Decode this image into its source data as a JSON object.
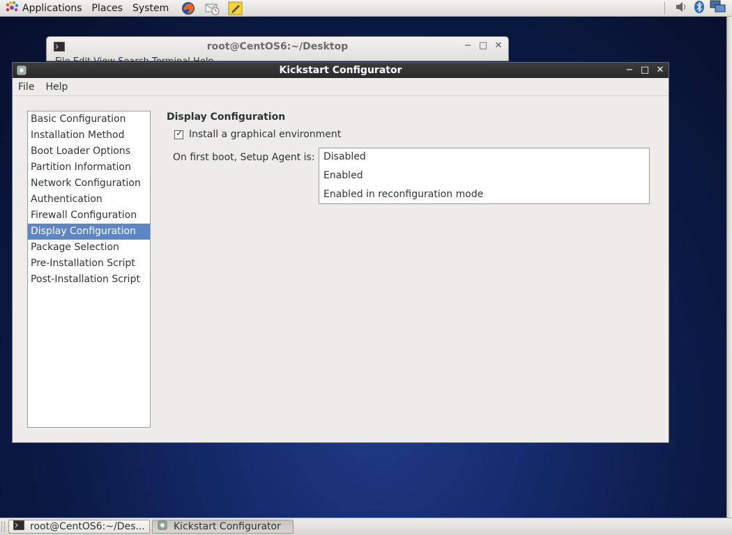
{
  "top_panel": {
    "menus": [
      {
        "label": "Applications",
        "icon": "gnome-foot-icon"
      },
      {
        "label": "Places"
      },
      {
        "label": "System"
      }
    ],
    "launchers": [
      "firefox-icon",
      "mail-clock-icon",
      "notes-icon"
    ],
    "tray_icons": [
      "volume-icon",
      "bluetooth-icon",
      "network-icon"
    ]
  },
  "terminal_window": {
    "title": "root@CentOS6:~/Desktop",
    "menu_partial": "File  Edit  View  Search  Terminal  Help"
  },
  "ks_window": {
    "title": "Kickstart Configurator",
    "menu": {
      "file": "File",
      "help": "Help"
    },
    "nav": {
      "items": [
        {
          "label": "Basic Configuration"
        },
        {
          "label": "Installation Method"
        },
        {
          "label": "Boot Loader Options"
        },
        {
          "label": "Partition Information"
        },
        {
          "label": "Network Configuration"
        },
        {
          "label": "Authentication"
        },
        {
          "label": "Firewall Configuration"
        },
        {
          "label": "Display Configuration"
        },
        {
          "label": "Package Selection"
        },
        {
          "label": "Pre-Installation Script"
        },
        {
          "label": "Post-Installation Script"
        }
      ],
      "selected": "Display Configuration"
    },
    "display": {
      "section_title": "Display Configuration",
      "install_graphical_label": "Install a graphical environment",
      "install_graphical_checked": true,
      "setup_agent_label": "On first boot, Setup Agent is:",
      "setup_agent_options": [
        "Disabled",
        "Enabled",
        "Enabled in reconfiguration mode"
      ]
    }
  },
  "taskbar": {
    "tasks": [
      {
        "label": "root@CentOS6:~/Des...",
        "icon": "terminal-icon"
      },
      {
        "label": "Kickstart Configurator",
        "icon": "kickstart-icon",
        "active": true
      }
    ]
  },
  "colors": {
    "selection": "#5e86c3",
    "titlebar": "#2f2f2f",
    "desktop": "#142a6a"
  }
}
